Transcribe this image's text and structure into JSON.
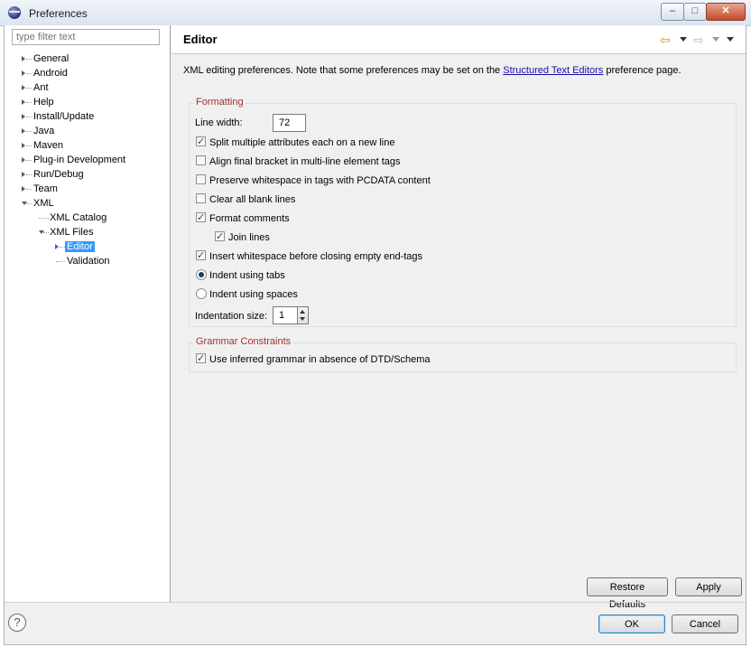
{
  "window": {
    "title": "Preferences",
    "min_label": "–",
    "max_label": "□",
    "close_label": "✕"
  },
  "filter": {
    "placeholder": "type filter text"
  },
  "tree": {
    "general": "General",
    "android": "Android",
    "ant": "Ant",
    "help": "Help",
    "install_update": "Install/Update",
    "java": "Java",
    "maven": "Maven",
    "plugin_development": "Plug-in Development",
    "run_debug": "Run/Debug",
    "team": "Team",
    "xml": "XML",
    "xml_catalog": "XML Catalog",
    "xml_files": "XML Files",
    "editor": "Editor",
    "validation": "Validation"
  },
  "header": {
    "title": "Editor",
    "back_icon": "⇦",
    "forward_icon": "⇨"
  },
  "description": {
    "prefix": "XML editing preferences.  Note that some preferences may be set on the ",
    "link": "Structured Text Editors",
    "suffix": " preference page."
  },
  "formatting": {
    "title": "Formatting",
    "line_width_label": "Line width:",
    "line_width_value": "72",
    "split_attributes": {
      "label": "Split multiple attributes each on a new line",
      "checked": true
    },
    "align_bracket": {
      "label": "Align final bracket in multi-line element tags",
      "checked": false
    },
    "preserve_whitespace": {
      "label": "Preserve whitespace in tags with PCDATA content",
      "checked": false
    },
    "clear_blank_lines": {
      "label": "Clear all blank lines",
      "checked": false
    },
    "format_comments": {
      "label": "Format comments",
      "checked": true
    },
    "join_lines": {
      "label": "Join lines",
      "checked": true
    },
    "insert_whitespace": {
      "label": "Insert whitespace before closing empty end-tags",
      "checked": true
    },
    "indent_tabs": {
      "label": "Indent using tabs",
      "selected": true
    },
    "indent_spaces": {
      "label": "Indent using spaces",
      "selected": false
    },
    "indentation_size_label": "Indentation size:",
    "indentation_size_value": "1"
  },
  "grammar": {
    "title": "Grammar Constraints",
    "use_inferred": {
      "label": "Use inferred grammar in absence of DTD/Schema",
      "checked": true
    }
  },
  "buttons": {
    "restore_defaults": "Restore Defaults",
    "apply": "Apply",
    "ok": "OK",
    "cancel": "Cancel",
    "help_icon": "?"
  },
  "colors": {
    "selection": "#3399ff",
    "group_title": "#a0322e",
    "link": "#1a0dab"
  }
}
